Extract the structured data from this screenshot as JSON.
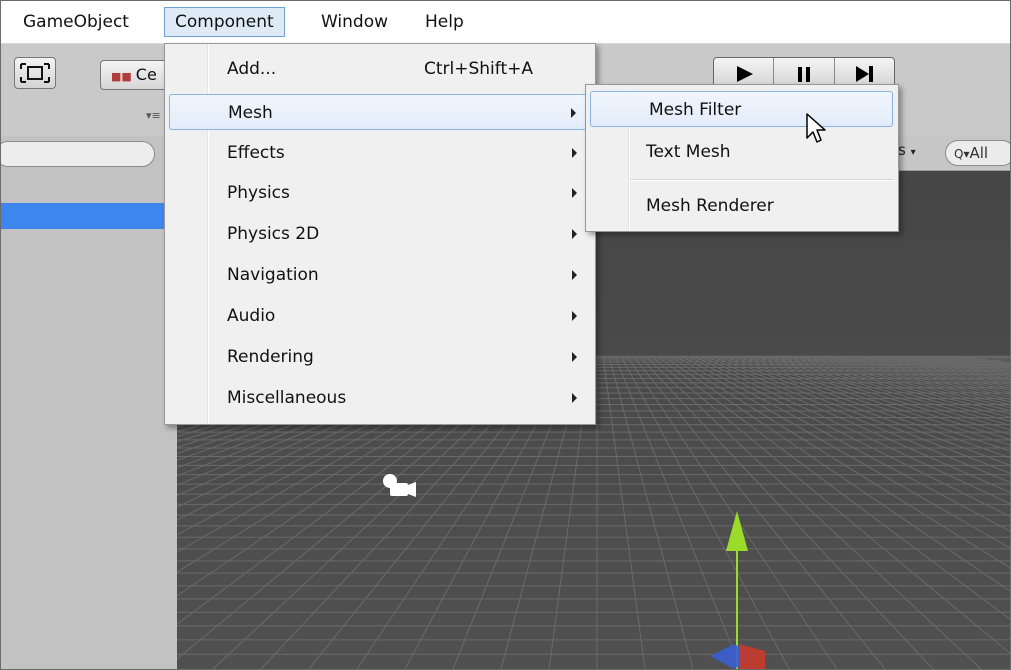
{
  "menubar": {
    "items": [
      "GameObject",
      "Component",
      "Window",
      "Help"
    ],
    "active": "Component"
  },
  "toolbar": {
    "pivot_label": "Ce",
    "play_icon": "play-icon",
    "pause_icon": "pause-icon",
    "step_icon": "step-icon"
  },
  "scene": {
    "gizmos_label": "s",
    "search_label": "All"
  },
  "component_menu": {
    "items": [
      {
        "label": "Add...",
        "shortcut": "Ctrl+Shift+A",
        "has_submenu": false
      },
      {
        "label": "Mesh",
        "has_submenu": true,
        "highlighted": true
      },
      {
        "label": "Effects",
        "has_submenu": true
      },
      {
        "label": "Physics",
        "has_submenu": true
      },
      {
        "label": "Physics 2D",
        "has_submenu": true
      },
      {
        "label": "Navigation",
        "has_submenu": true
      },
      {
        "label": "Audio",
        "has_submenu": true
      },
      {
        "label": "Rendering",
        "has_submenu": true
      },
      {
        "label": "Miscellaneous",
        "has_submenu": true
      }
    ]
  },
  "mesh_submenu": {
    "items": [
      {
        "label": "Mesh Filter",
        "highlighted": true
      },
      {
        "label": "Text Mesh"
      },
      {
        "label": "Mesh Renderer"
      }
    ]
  },
  "colors": {
    "menu_highlight_border": "#8cb2e2",
    "selection_blue": "#3d86ef",
    "scene_background": "#464646",
    "gizmo_y_axis": "#9bdb2a"
  }
}
